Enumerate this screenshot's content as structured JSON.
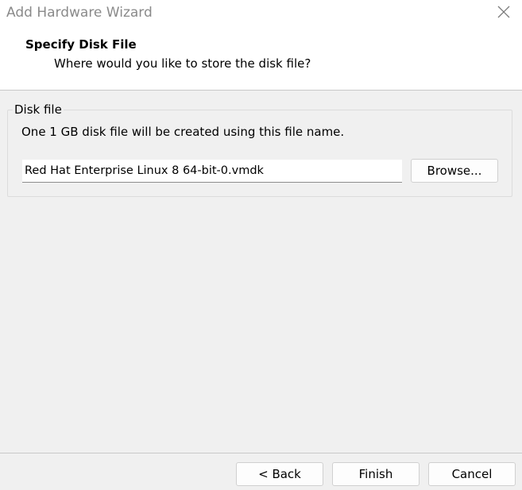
{
  "window": {
    "title": "Add Hardware Wizard"
  },
  "header": {
    "title": "Specify Disk File",
    "subtitle": "Where would you like to store the disk file?"
  },
  "disk_file_group": {
    "legend": "Disk file",
    "description": "One 1 GB disk file will be created using this file name.",
    "file_name_value": "Red Hat Enterprise Linux 8 64-bit-0.vmdk",
    "browse_label": "Browse..."
  },
  "footer": {
    "back_label": "< Back",
    "finish_label": "Finish",
    "cancel_label": "Cancel"
  },
  "icons": {
    "close": "close-icon"
  },
  "colors": {
    "window_bg": "#f0f0f0",
    "header_bg": "#ffffff",
    "title_text": "#8a8a8a"
  }
}
